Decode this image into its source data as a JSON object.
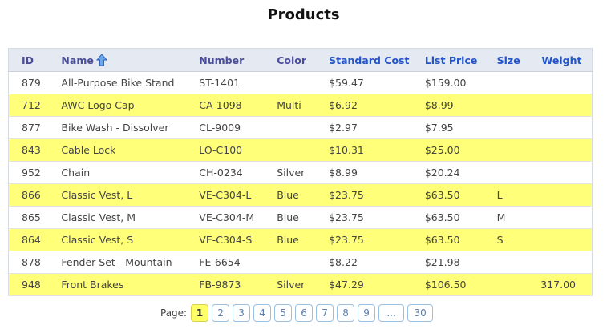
{
  "title": "Products",
  "columns": [
    "ID",
    "Name",
    "Number",
    "Color",
    "Standard Cost",
    "List Price",
    "Size",
    "Weight"
  ],
  "rows": [
    [
      "879",
      "All-Purpose Bike Stand",
      "ST-1401",
      "",
      "$59.47",
      "$159.00",
      "",
      ""
    ],
    [
      "712",
      "AWC Logo Cap",
      "CA-1098",
      "Multi",
      "$6.92",
      "$8.99",
      "",
      ""
    ],
    [
      "877",
      "Bike Wash - Dissolver",
      "CL-9009",
      "",
      "$2.97",
      "$7.95",
      "",
      ""
    ],
    [
      "843",
      "Cable Lock",
      "LO-C100",
      "",
      "$10.31",
      "$25.00",
      "",
      ""
    ],
    [
      "952",
      "Chain",
      "CH-0234",
      "Silver",
      "$8.99",
      "$20.24",
      "",
      ""
    ],
    [
      "866",
      "Classic Vest, L",
      "VE-C304-L",
      "Blue",
      "$23.75",
      "$63.50",
      "L",
      ""
    ],
    [
      "865",
      "Classic Vest, M",
      "VE-C304-M",
      "Blue",
      "$23.75",
      "$63.50",
      "M",
      ""
    ],
    [
      "864",
      "Classic Vest, S",
      "VE-C304-S",
      "Blue",
      "$23.75",
      "$63.50",
      "S",
      ""
    ],
    [
      "878",
      "Fender Set - Mountain",
      "FE-6654",
      "",
      "$8.22",
      "$21.98",
      "",
      ""
    ],
    [
      "948",
      "Front Brakes",
      "FB-9873",
      "Silver",
      "$47.29",
      "$106.50",
      "",
      "317.00"
    ]
  ],
  "pager": {
    "label": "Page:",
    "pages": [
      "1",
      "2",
      "3",
      "4",
      "5",
      "6",
      "7",
      "8",
      "9",
      "...",
      "30"
    ],
    "current": "1"
  },
  "colors": {
    "alt_row": "#ffff7a",
    "header_bg": "#e4e9f2",
    "sort_link": "#2255c8"
  }
}
